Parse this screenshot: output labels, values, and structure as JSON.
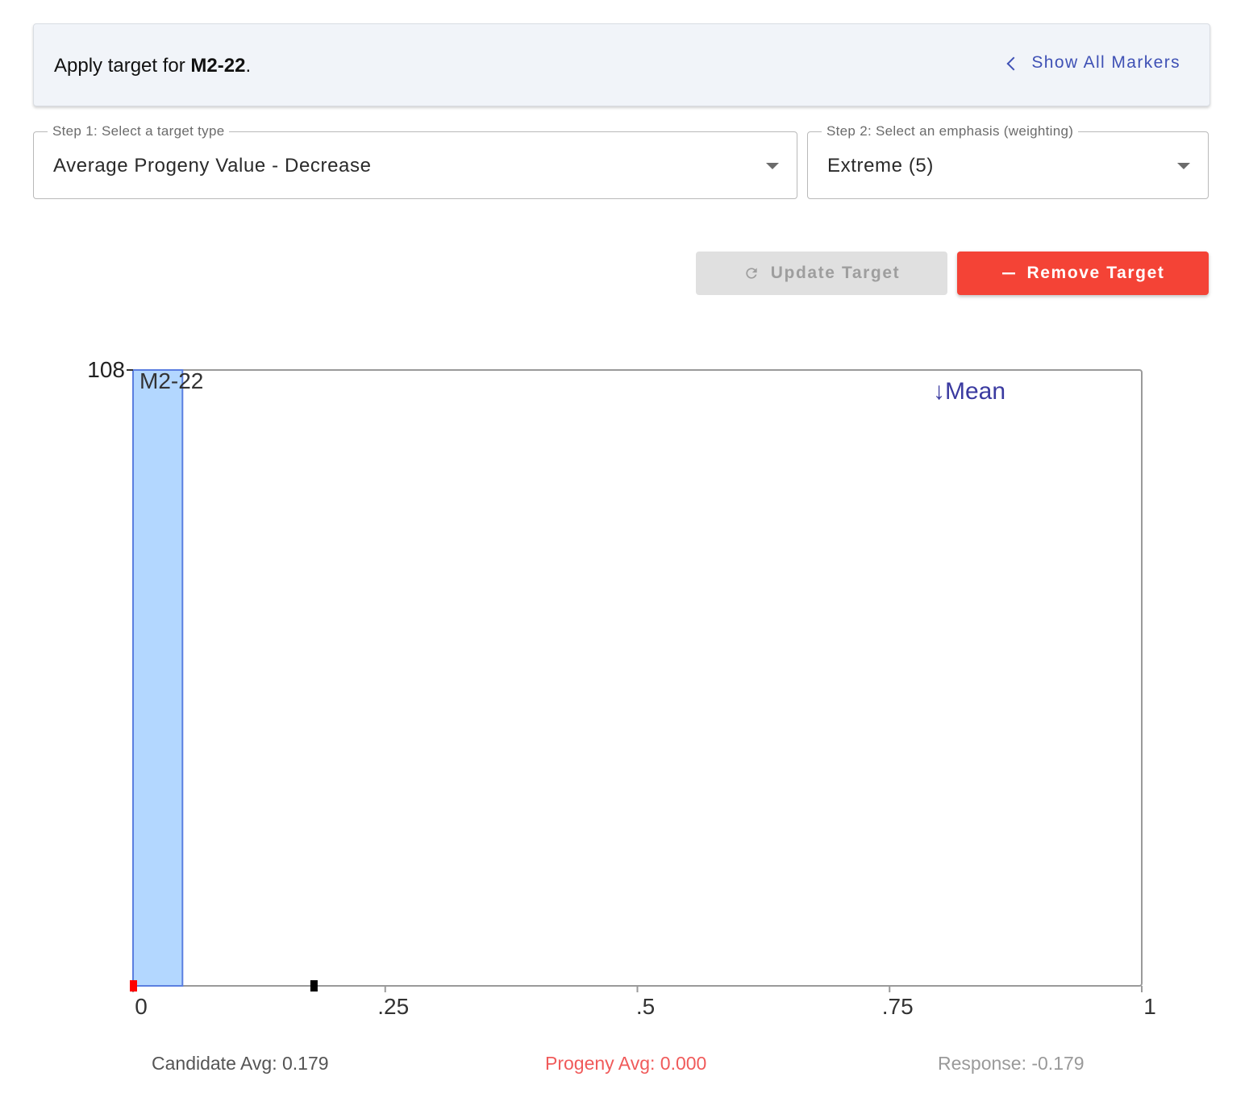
{
  "banner": {
    "prefix": "Apply target for ",
    "marker": "M2-22",
    "suffix": ".",
    "show_all_label": "Show All Markers"
  },
  "step1": {
    "legend": "Step 1: Select a target type",
    "value": "Average Progeny Value - Decrease"
  },
  "step2": {
    "legend": "Step 2: Select an emphasis (weighting)",
    "value": "Extreme (5)"
  },
  "buttons": {
    "update_label": "Update Target",
    "remove_label": "Remove Target"
  },
  "colors": {
    "accent": "#3f51b5",
    "remove": "#f44336",
    "bar_fill": "#b3d7ff",
    "bar_stroke": "#5b7fe0",
    "mean_label": "#3a3aa0",
    "progeny_marker": "#ff0000",
    "candidate_marker": "#000000"
  },
  "chart_data": {
    "type": "bar",
    "title": "",
    "xlabel": "",
    "ylabel": "",
    "xlim": [
      0,
      1
    ],
    "ylim": [
      0,
      108
    ],
    "x_ticks": [
      0,
      0.25,
      0.5,
      0.75,
      1
    ],
    "x_tick_labels": [
      "0",
      ".25",
      ".5",
      ".75",
      "1"
    ],
    "y_ticks": [
      108
    ],
    "y_tick_labels": [
      "108"
    ],
    "bars": [
      {
        "label": "M2-22",
        "x0": 0,
        "x1": 0.049,
        "value": 108
      }
    ],
    "markers": {
      "candidate_avg": 0.179,
      "progeny_avg": 0.0
    },
    "mean_label": "↓Mean",
    "legend_position": "top-right"
  },
  "stats": {
    "candidate": "Candidate Avg: 0.179",
    "progeny": "Progeny Avg: 0.000",
    "response": "Response: -0.179"
  }
}
